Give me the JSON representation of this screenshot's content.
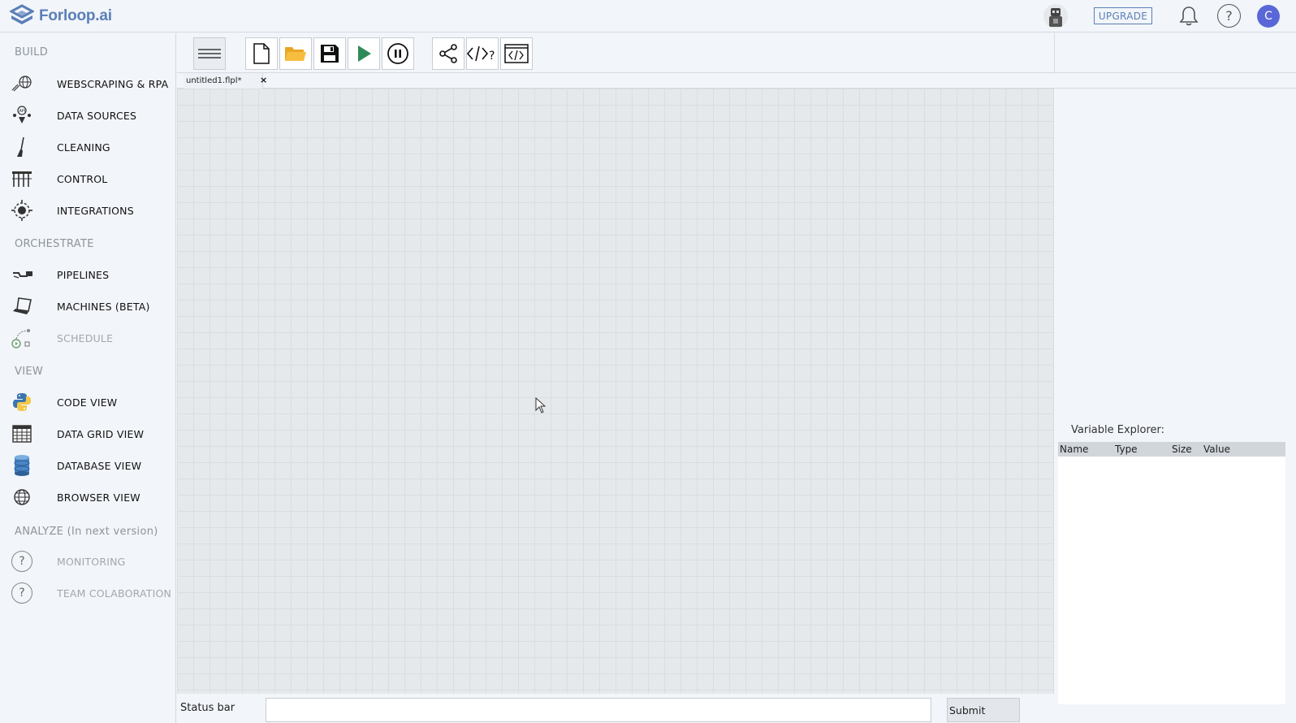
{
  "app": {
    "brand": "Forloop.ai"
  },
  "topbar": {
    "upgrade_label": "UPGRADE",
    "user_initial": "C"
  },
  "sidebar": {
    "sections": [
      {
        "title": "BUILD",
        "items": [
          {
            "label": "WEBSCRAPING & RPA",
            "icon": "globe-cursor-icon",
            "enabled": true
          },
          {
            "label": "DATA SOURCES",
            "icon": "data-sources-icon",
            "enabled": true
          },
          {
            "label": "CLEANING",
            "icon": "broom-icon",
            "enabled": true
          },
          {
            "label": "CONTROL",
            "icon": "control-icon",
            "enabled": true
          },
          {
            "label": "INTEGRATIONS",
            "icon": "integrations-icon",
            "enabled": true
          }
        ]
      },
      {
        "title": "ORCHESTRATE",
        "items": [
          {
            "label": "PIPELINES",
            "icon": "pipelines-icon",
            "enabled": true
          },
          {
            "label": "MACHINES (BETA)",
            "icon": "laptop-icon",
            "enabled": true
          },
          {
            "label": "SCHEDULE",
            "icon": "schedule-icon",
            "enabled": false
          }
        ]
      },
      {
        "title": "VIEW",
        "items": [
          {
            "label": "CODE VIEW",
            "icon": "python-icon",
            "enabled": true
          },
          {
            "label": "DATA GRID VIEW",
            "icon": "grid-icon",
            "enabled": true
          },
          {
            "label": "DATABASE VIEW",
            "icon": "database-icon",
            "enabled": true
          },
          {
            "label": "BROWSER VIEW",
            "icon": "globe-icon",
            "enabled": true
          }
        ]
      },
      {
        "title": "ANALYZE (In next version)",
        "items": [
          {
            "label": "MONITORING",
            "icon": "question-icon",
            "enabled": false
          },
          {
            "label": "TEAM COLABORATION",
            "icon": "question-icon",
            "enabled": false
          }
        ]
      }
    ]
  },
  "tabs": [
    {
      "label": "untitled1.flpl*",
      "close": "×"
    }
  ],
  "variable_explorer": {
    "title": "Variable Explorer:",
    "columns": [
      "Name",
      "Type",
      "Size",
      "Value"
    ]
  },
  "statusbar": {
    "label": "Status bar",
    "input_value": "",
    "submit_label": "Submit"
  },
  "colors": {
    "brand": "#5a7fb8",
    "accent": "#5a67d8",
    "play": "#2e8b57"
  }
}
